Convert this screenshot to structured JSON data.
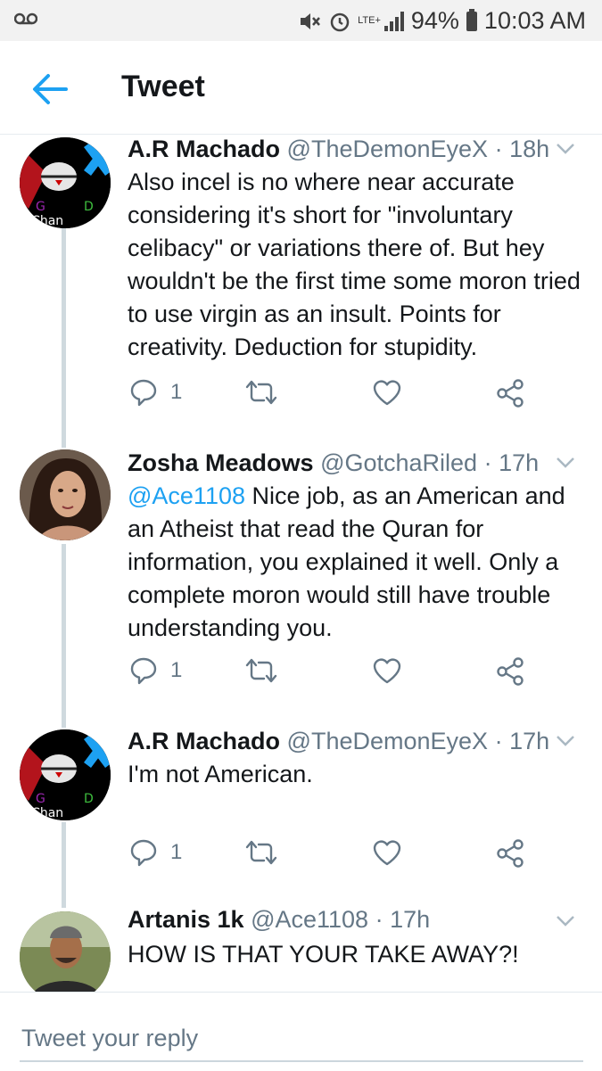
{
  "status_bar": {
    "battery": "94%",
    "time": "10:03 AM",
    "network": "LTE+"
  },
  "header": {
    "title": "Tweet"
  },
  "tweets": [
    {
      "name": "A.R Machado",
      "handle": "@TheDemonEyeX",
      "time": "· 18h",
      "mention": "",
      "text": "Also incel is no where near accurate considering it's short for \"involuntary celibacy\" or variations there of. But hey wouldn't be the first time some moron tried to use virgin as an insult. Points for creativity. Deduction for stupidity.",
      "reply_count": "1",
      "avatar_text": [
        "G",
        "D",
        "e Chan"
      ]
    },
    {
      "name": "Zosha Meadows",
      "handle": "@GotchaRiled",
      "time": "· 17h",
      "mention": "@Ace1108",
      "text": " Nice job, as an American and an Atheist that read the Quran for information, you explained it well. Only a complete moron would still have trouble understanding you.",
      "reply_count": "1"
    },
    {
      "name": "A.R Machado",
      "handle": "@TheDemonEyeX",
      "time": "· 17h",
      "mention": "",
      "text": "I'm not American.",
      "reply_count": "1",
      "avatar_text": [
        "G",
        "D",
        "e Chan"
      ]
    },
    {
      "name": "Artanis 1k",
      "handle": "@Ace1108",
      "time": "· 17h",
      "mention": "",
      "text": "HOW IS THAT YOUR TAKE AWAY?!"
    }
  ],
  "reply": {
    "placeholder": "Tweet your reply"
  },
  "icons": {
    "back": "arrow-left-icon",
    "reply": "reply-icon",
    "retweet": "retweet-icon",
    "like": "heart-icon",
    "share": "share-icon",
    "more": "chevron-down-icon"
  },
  "colors": {
    "accent": "#1da1f2",
    "secondary_text": "#657786",
    "thread_line": "#cfd9de"
  }
}
